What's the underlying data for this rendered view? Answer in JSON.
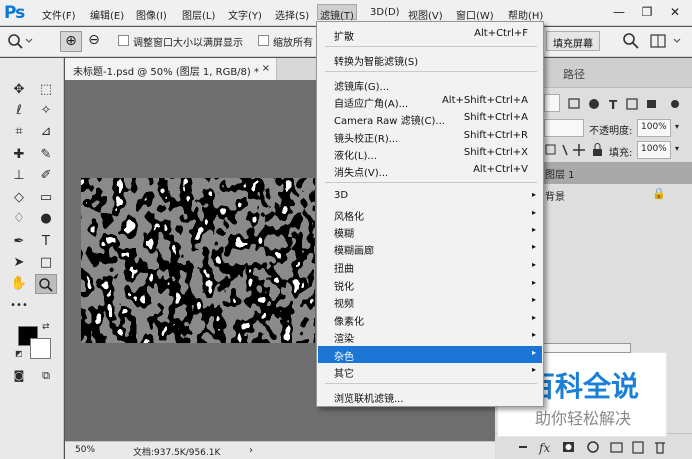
{
  "app": {
    "logo": "Ps"
  },
  "menubar": {
    "items": [
      "文件(F)",
      "编辑(E)",
      "图像(I)",
      "图层(L)",
      "文字(Y)",
      "选择(S)",
      "滤镜(T)",
      "3D(D)",
      "视图(V)",
      "窗口(W)",
      "帮助(H)"
    ],
    "active": "滤镜(T)"
  },
  "window_controls": {
    "minimize": "—",
    "restore": "❐",
    "close": "✕"
  },
  "options_bar": {
    "zoom_in": "⊕",
    "zoom_out": "⊖",
    "resize_windows_label": "调整窗口大小以满屏显示",
    "zoom_all_label": "缩放所有",
    "fill_screen_label": "填充屏幕"
  },
  "document": {
    "tab_title": "未标题-1.psd @ 50% (图层 1, RGB/8) *",
    "close": "×",
    "zoom": "50%",
    "doc_info": "文档:937.5K/956.1K"
  },
  "right_panel": {
    "tab_paths": "路径",
    "opacity_label": "不透明度:",
    "opacity_value": "100%",
    "fill_label": "填充:",
    "fill_value": "100%",
    "layers": [
      "图层 1",
      "背景"
    ]
  },
  "filter_menu": {
    "items": [
      {
        "label": "扩散",
        "shortcut": "Alt+Ctrl+F"
      },
      {
        "label": "转换为智能滤镜(S)",
        "shortcut": ""
      },
      {
        "label": "滤镜库(G)...",
        "shortcut": ""
      },
      {
        "label": "自适应广角(A)...",
        "shortcut": "Alt+Shift+Ctrl+A"
      },
      {
        "label": "Camera Raw 滤镜(C)...",
        "shortcut": "Shift+Ctrl+A"
      },
      {
        "label": "镜头校正(R)...",
        "shortcut": "Shift+Ctrl+R"
      },
      {
        "label": "液化(L)...",
        "shortcut": "Shift+Ctrl+X"
      },
      {
        "label": "消失点(V)...",
        "shortcut": "Alt+Ctrl+V"
      },
      {
        "label": "3D",
        "shortcut": ""
      },
      {
        "label": "风格化",
        "shortcut": ""
      },
      {
        "label": "模糊",
        "shortcut": ""
      },
      {
        "label": "模糊画廊",
        "shortcut": ""
      },
      {
        "label": "扭曲",
        "shortcut": ""
      },
      {
        "label": "锐化",
        "shortcut": ""
      },
      {
        "label": "视频",
        "shortcut": ""
      },
      {
        "label": "像素化",
        "shortcut": ""
      },
      {
        "label": "渲染",
        "shortcut": ""
      },
      {
        "label": "杂色",
        "shortcut": ""
      },
      {
        "label": "其它",
        "shortcut": ""
      },
      {
        "label": "浏览联机滤镜...",
        "shortcut": ""
      }
    ],
    "highlighted": "杂色",
    "submenu_arrow": "▸"
  },
  "watermark": {
    "title": "百科全说",
    "subtitle": "助你轻松解决"
  }
}
